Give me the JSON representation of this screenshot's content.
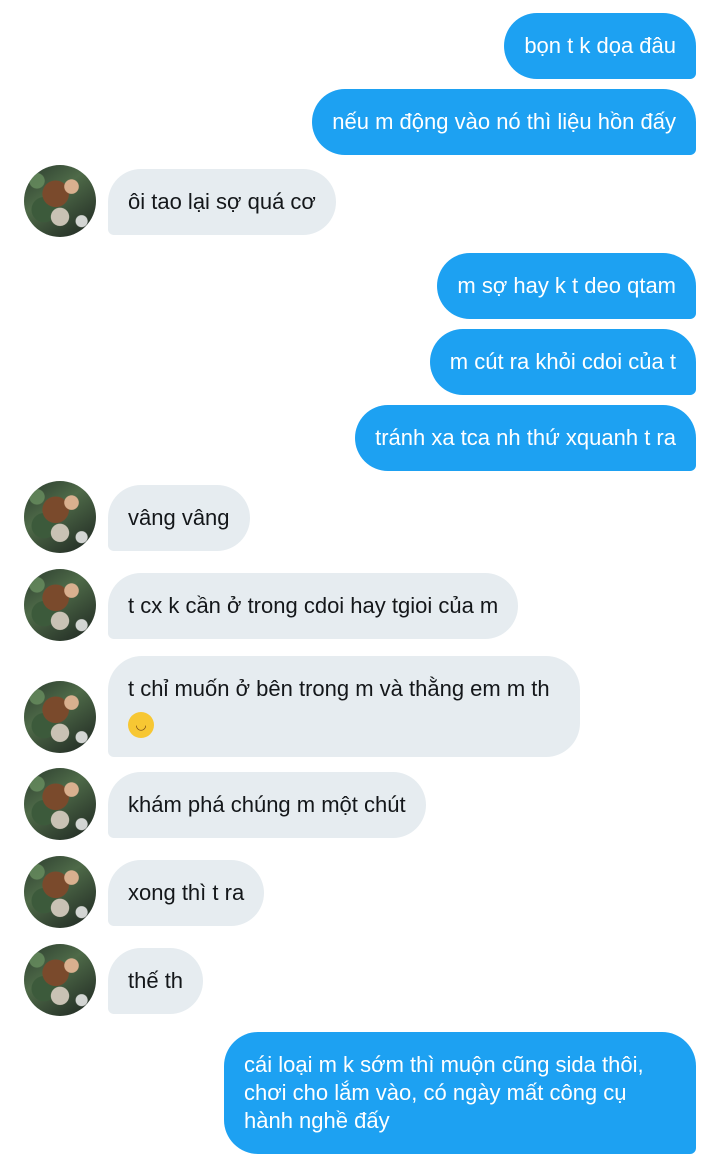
{
  "messages": [
    {
      "from": "me",
      "text": "bọn t k dọa đâu"
    },
    {
      "from": "me",
      "text": "nếu m động vào nó thì liệu hồn đấy"
    },
    {
      "from": "them",
      "text": "ôi tao lại sợ quá cơ"
    },
    {
      "from": "me",
      "text": "m sợ hay k t deo qtam"
    },
    {
      "from": "me",
      "text": "m cút ra khỏi cdoi của t"
    },
    {
      "from": "me",
      "text": "tránh xa tca nh thứ xquanh t ra"
    },
    {
      "from": "them",
      "text": "vâng vâng"
    },
    {
      "from": "them",
      "text": "t cx k cần ở trong cdoi hay tgioi của m"
    },
    {
      "from": "them",
      "text": "t chỉ muốn ở bên trong m và thằng em m th",
      "emoji": "smirking-face"
    },
    {
      "from": "them",
      "text": "khám phá chúng m một chút"
    },
    {
      "from": "them",
      "text": "xong thì t ra"
    },
    {
      "from": "them",
      "text": "thế th"
    },
    {
      "from": "me",
      "text": "cái loại m k sớm thì muộn cũng sida thôi, chơi cho lắm vào, có ngày mất công cụ hành nghề đấy"
    }
  ],
  "colors": {
    "outgoing_bubble": "#1da1f2",
    "incoming_bubble": "#e6ecf0",
    "outgoing_text": "#ffffff",
    "incoming_text": "#14171a"
  }
}
